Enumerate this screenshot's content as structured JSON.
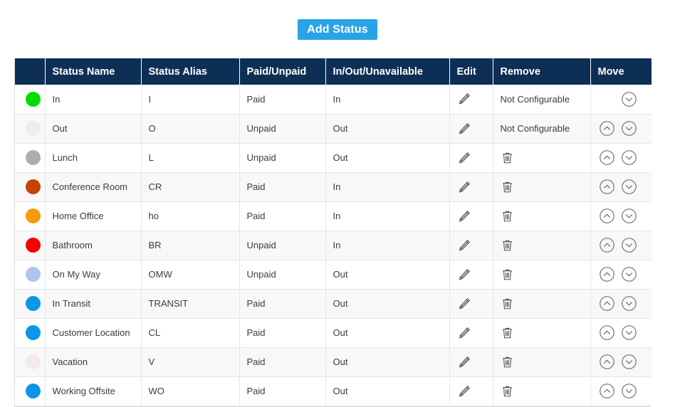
{
  "toolbar": {
    "add_status_label": "Add Status",
    "add_status_color": "#29a3e8"
  },
  "table": {
    "header_bg": "#0e2f55",
    "columns": [
      {
        "key": "dot",
        "label": ""
      },
      {
        "key": "name",
        "label": "Status Name"
      },
      {
        "key": "alias",
        "label": "Status Alias"
      },
      {
        "key": "paid",
        "label": "Paid/Unpaid"
      },
      {
        "key": "inout",
        "label": "In/Out/Unavailable"
      },
      {
        "key": "edit",
        "label": "Edit"
      },
      {
        "key": "remove",
        "label": "Remove"
      },
      {
        "key": "move",
        "label": "Move"
      }
    ],
    "not_configurable_label": "Not Configurable",
    "rows": [
      {
        "color": "#00dd00",
        "name": "In",
        "alias": "I",
        "paid": "Paid",
        "inout": "In",
        "edit": true,
        "removable": false,
        "move_up": false,
        "move_down": true
      },
      {
        "color": "#f2eaee",
        "name": "Out",
        "alias": "O",
        "paid": "Unpaid",
        "inout": "Out",
        "edit": true,
        "removable": false,
        "move_up": true,
        "move_down": true
      },
      {
        "color": "#adadad",
        "name": "Lunch",
        "alias": "L",
        "paid": "Unpaid",
        "inout": "Out",
        "edit": true,
        "removable": true,
        "move_up": true,
        "move_down": true
      },
      {
        "color": "#c44400",
        "name": "Conference Room",
        "alias": "CR",
        "paid": "Paid",
        "inout": "In",
        "edit": true,
        "removable": true,
        "move_up": true,
        "move_down": true
      },
      {
        "color": "#f79b0c",
        "name": "Home Office",
        "alias": "ho",
        "paid": "Paid",
        "inout": "In",
        "edit": true,
        "removable": true,
        "move_up": true,
        "move_down": true
      },
      {
        "color": "#f60000",
        "name": "Bathroom",
        "alias": "BR",
        "paid": "Unpaid",
        "inout": "In",
        "edit": true,
        "removable": true,
        "move_up": true,
        "move_down": true
      },
      {
        "color": "#b0c4ef",
        "name": "On My Way",
        "alias": "OMW",
        "paid": "Unpaid",
        "inout": "Out",
        "edit": true,
        "removable": true,
        "move_up": true,
        "move_down": true
      },
      {
        "color": "#0b96e8",
        "name": "In Transit",
        "alias": "TRANSIT",
        "paid": "Paid",
        "inout": "Out",
        "edit": true,
        "removable": true,
        "move_up": true,
        "move_down": true
      },
      {
        "color": "#0b96e8",
        "name": "Customer Location",
        "alias": "CL",
        "paid": "Paid",
        "inout": "Out",
        "edit": true,
        "removable": true,
        "move_up": true,
        "move_down": true
      },
      {
        "color": "#f2eaee",
        "name": "Vacation",
        "alias": "V",
        "paid": "Paid",
        "inout": "Out",
        "edit": true,
        "removable": true,
        "move_up": true,
        "move_down": true
      },
      {
        "color": "#0b96e8",
        "name": "Working Offsite",
        "alias": "WO",
        "paid": "Paid",
        "inout": "Out",
        "edit": true,
        "removable": true,
        "move_up": true,
        "move_down": true
      }
    ]
  }
}
